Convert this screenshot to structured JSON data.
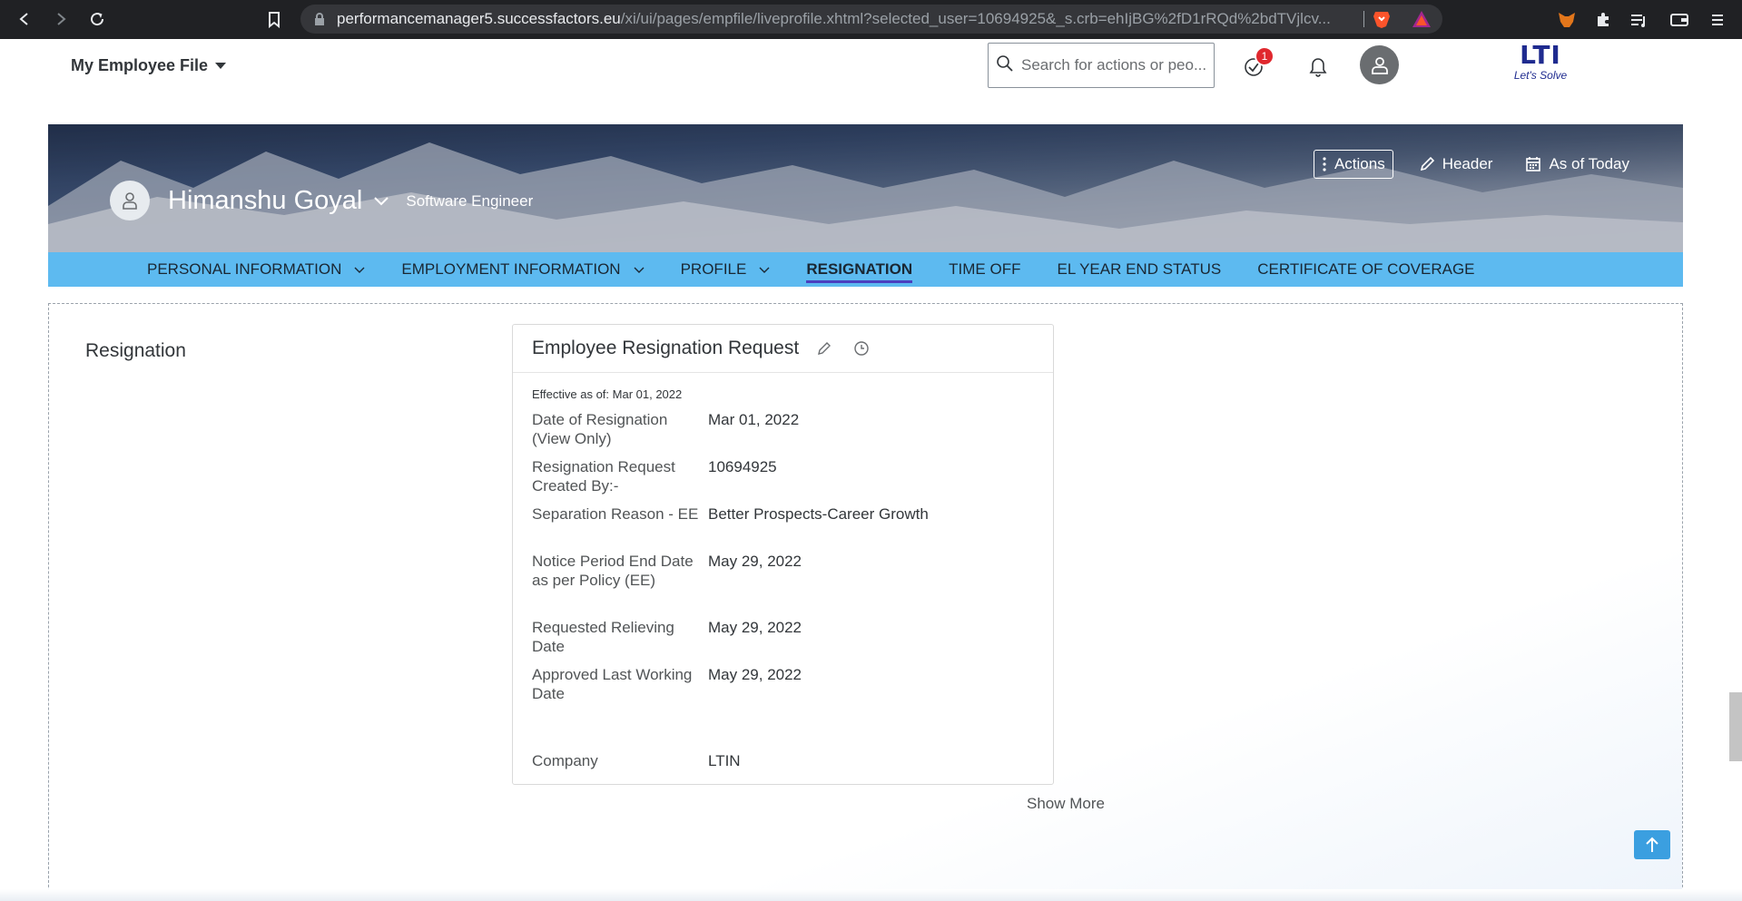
{
  "browser": {
    "url_host": "performancemanager5.successfactors.eu",
    "url_path": "/xi/ui/pages/empfile/liveprofile.xhtml?selected_user=10694925&_s.crb=ehIjBG%2fD1rRQd%2bdTVjlcv..."
  },
  "header": {
    "page_title": "My Employee File",
    "search_placeholder": "Search for actions or peo...",
    "todo_badge": "1",
    "logo_text": "LTI",
    "logo_tagline": "Let's Solve"
  },
  "hero": {
    "name": "Himanshu Goyal",
    "job_title": "Software Engineer",
    "actions_label": "Actions",
    "header_label": "Header",
    "as_of_label": "As of Today"
  },
  "tabs": [
    {
      "label": "PERSONAL INFORMATION",
      "has_menu": true
    },
    {
      "label": "EMPLOYMENT INFORMATION",
      "has_menu": true
    },
    {
      "label": "PROFILE",
      "has_menu": true
    },
    {
      "label": "RESIGNATION",
      "active": true
    },
    {
      "label": "TIME OFF"
    },
    {
      "label": "EL YEAR END STATUS"
    },
    {
      "label": "CERTIFICATE OF COVERAGE"
    }
  ],
  "section": {
    "title": "Resignation"
  },
  "card": {
    "title": "Employee Resignation Request",
    "effective": "Effective as of: Mar 01, 2022",
    "fields": [
      {
        "label": "Date of Resignation (View Only)",
        "value": "Mar 01, 2022"
      },
      {
        "label": "Resignation Request Created By:-",
        "value": "10694925"
      },
      {
        "label": "Separation Reason - EE",
        "value": "Better Prospects-Career Growth"
      },
      {
        "label": "Notice Period End Date as per Policy (EE)",
        "value": "May 29, 2022"
      },
      {
        "label": "Requested Relieving Date",
        "value": "May 29, 2022"
      },
      {
        "label": "Approved Last Working Date",
        "value": "May 29, 2022"
      },
      {
        "label": "Company",
        "value": "LTIN"
      }
    ],
    "show_more": "Show More"
  },
  "colors": {
    "tab_bar": "#5dbaf0",
    "active_tab_underline": "#4a3fbf",
    "badge": "#e0282e",
    "scroll_top_button": "#3b9fe0"
  },
  "icons": {
    "back": "back-arrow-icon",
    "forward": "forward-arrow-icon",
    "reload": "reload-icon",
    "bookmark": "bookmark-icon",
    "todo": "checkmark-circle-icon",
    "notifications": "bell-icon",
    "edit": "pencil-icon",
    "history": "clock-icon",
    "calendar": "calendar-icon",
    "scroll_top": "arrow-up-icon"
  }
}
